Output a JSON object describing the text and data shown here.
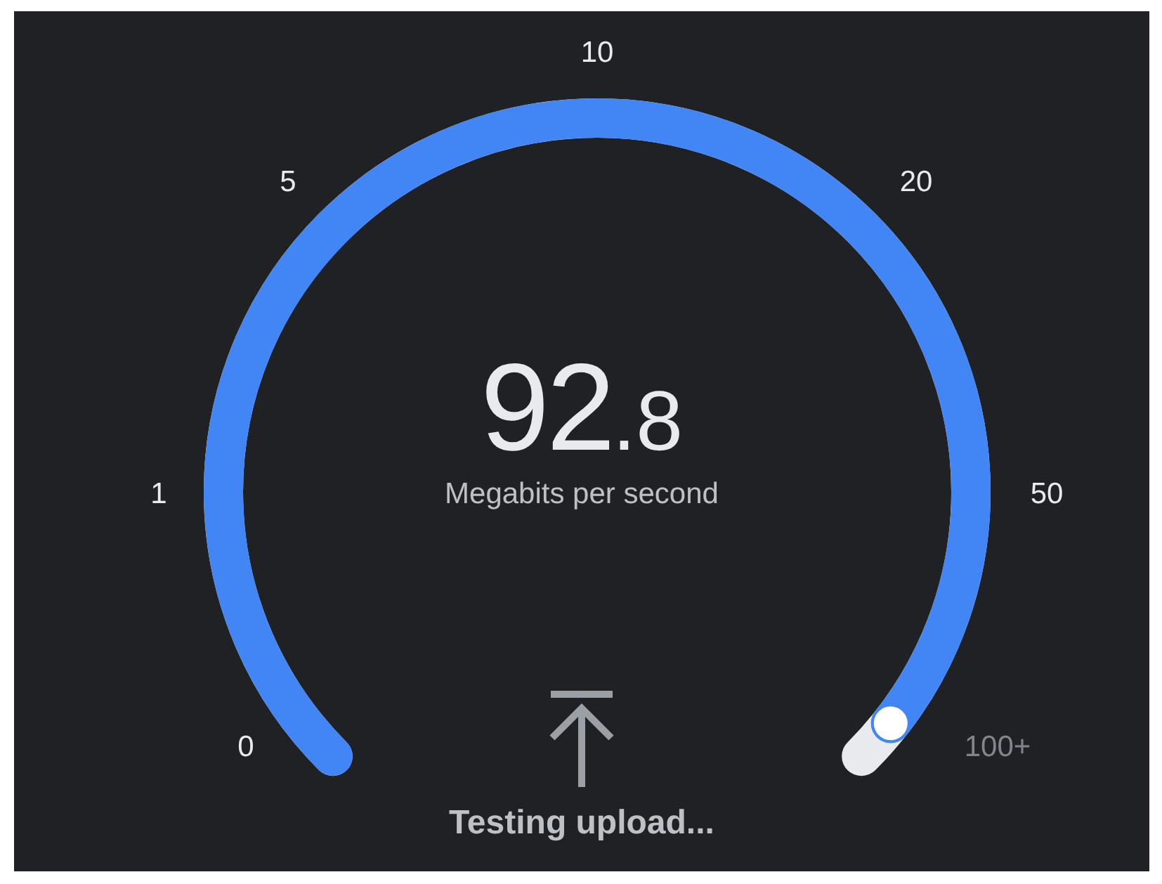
{
  "gauge": {
    "ticks": [
      {
        "label": "0",
        "reached": true
      },
      {
        "label": "1",
        "reached": true
      },
      {
        "label": "5",
        "reached": true
      },
      {
        "label": "10",
        "reached": true
      },
      {
        "label": "20",
        "reached": true
      },
      {
        "label": "50",
        "reached": true
      },
      {
        "label": "100+",
        "reached": false
      }
    ],
    "value_whole": "92",
    "value_fraction": ".8",
    "unit": "Megabits per second"
  },
  "status": "Testing upload..."
}
